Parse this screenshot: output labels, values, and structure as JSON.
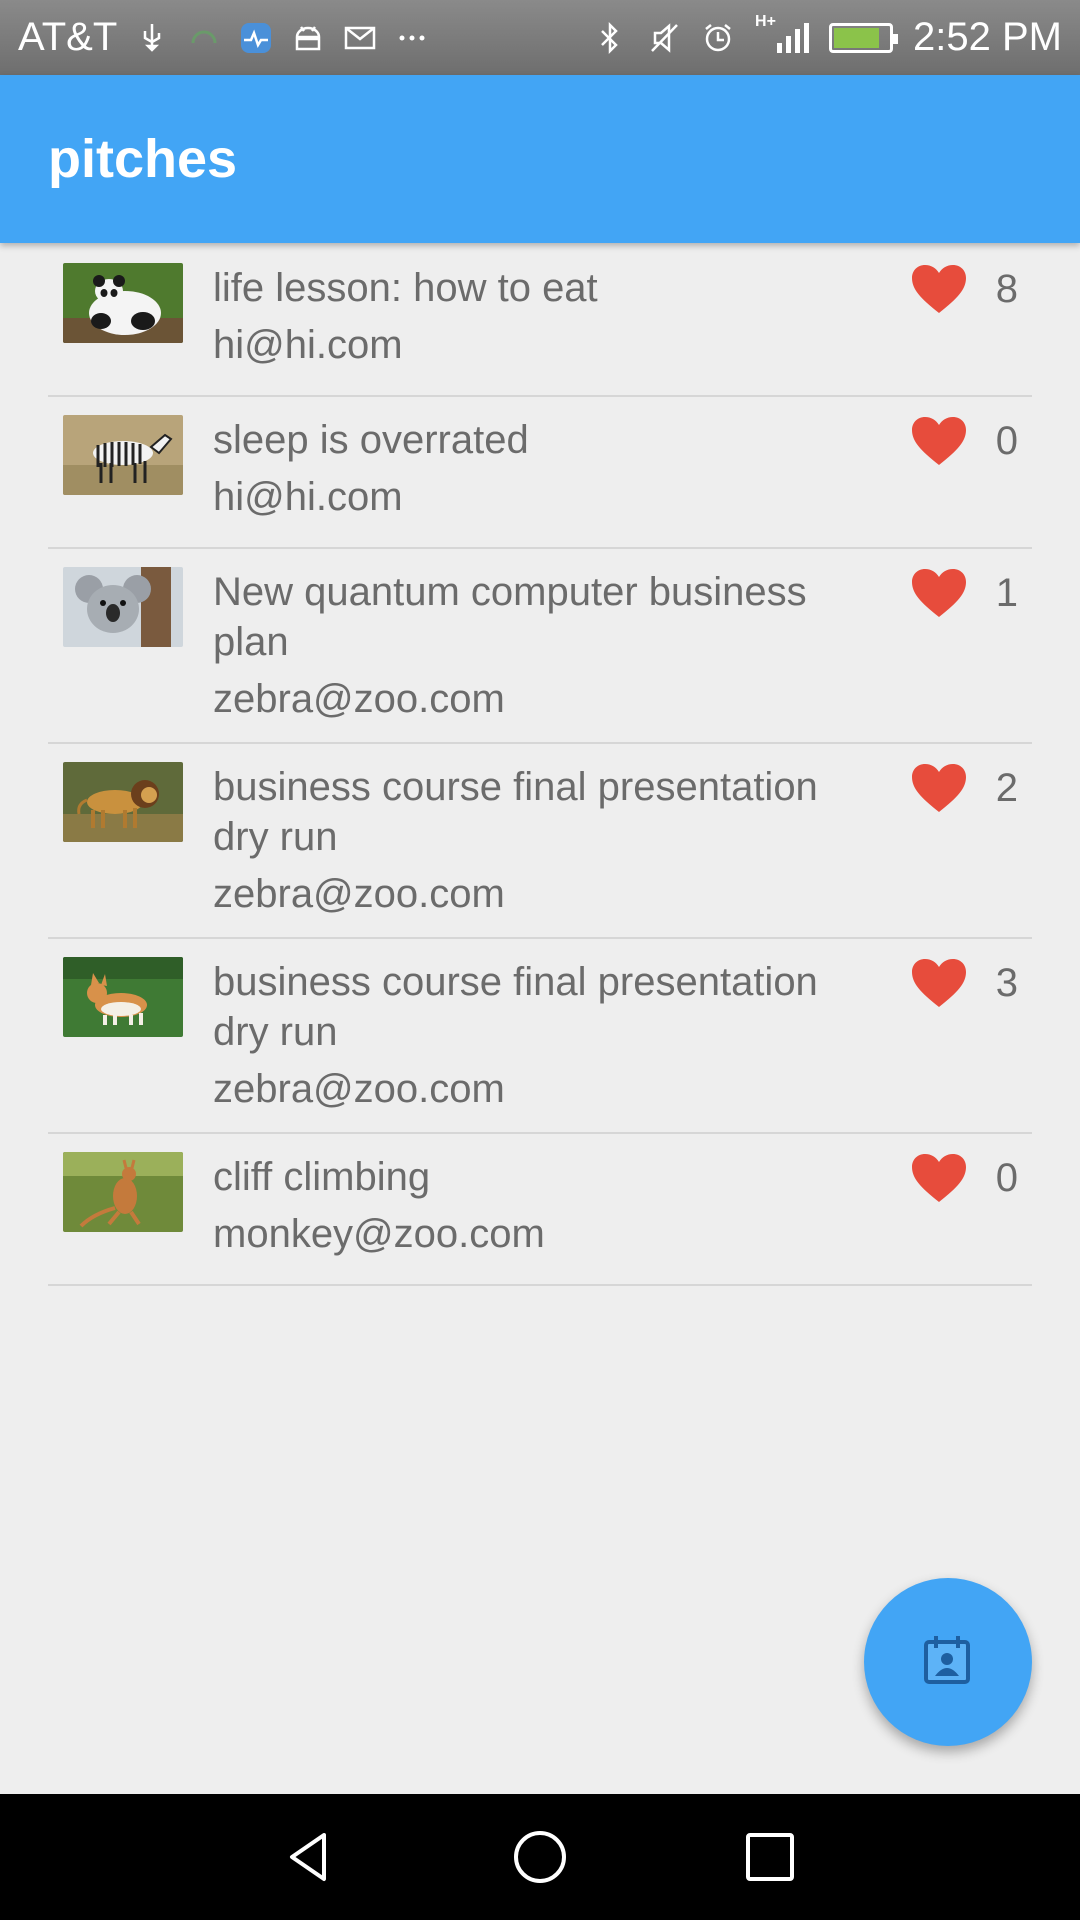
{
  "status_bar": {
    "carrier": "AT&T",
    "time": "2:52 PM",
    "icons": [
      "usb-icon",
      "headset-icon",
      "health-app-icon",
      "android-debug-icon",
      "mail-icon",
      "more-notifications-icon",
      "bluetooth-icon",
      "vibrate-off-icon",
      "alarm-icon",
      "signal-icon",
      "battery-charging-icon"
    ],
    "network_label": "H+"
  },
  "app_bar": {
    "title": "pitches"
  },
  "pitches": [
    {
      "title": "life lesson: how to eat",
      "email": "hi@hi.com",
      "likes": "8",
      "thumb": "panda"
    },
    {
      "title": "sleep is overrated",
      "email": "hi@hi.com",
      "likes": "0",
      "thumb": "zebra"
    },
    {
      "title": "New quantum computer business plan",
      "email": "zebra@zoo.com",
      "likes": "1",
      "thumb": "koala"
    },
    {
      "title": "business course final presentation dry run",
      "email": "zebra@zoo.com",
      "likes": "2",
      "thumb": "lion"
    },
    {
      "title": "business course final presentation dry run",
      "email": "zebra@zoo.com",
      "likes": "3",
      "thumb": "corgi"
    },
    {
      "title": "cliff climbing",
      "email": "monkey@zoo.com",
      "likes": "0",
      "thumb": "kangaroo"
    }
  ],
  "fab": {
    "icon": "calendar-contact-icon"
  },
  "nav_bar": {
    "buttons": [
      "back-icon",
      "home-icon",
      "recents-icon"
    ]
  },
  "colors": {
    "accent": "#42a5f5",
    "heart": "#e74c3c",
    "text": "#6b6b6b",
    "background": "#eeeeee"
  }
}
